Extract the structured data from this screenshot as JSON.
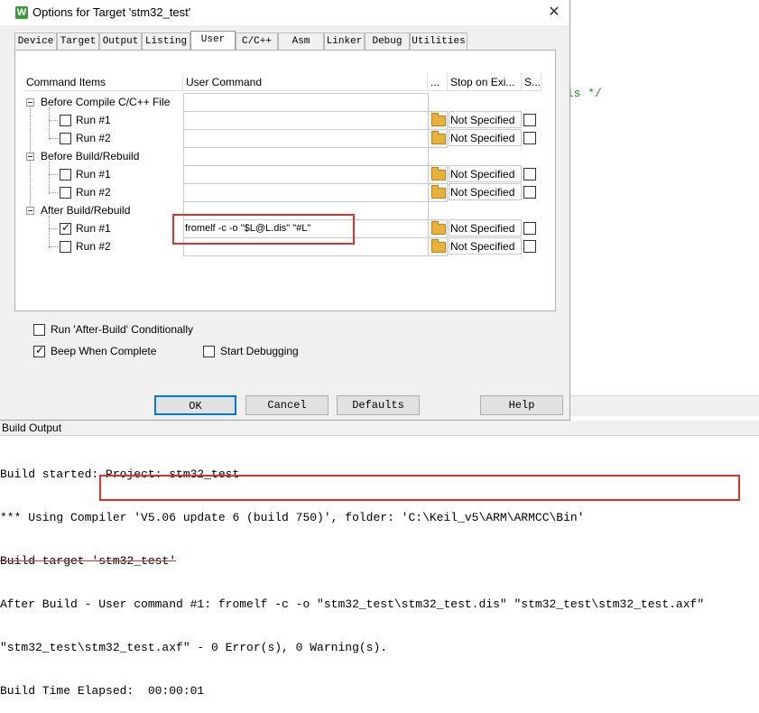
{
  "background": {
    "code_snippet": "als */"
  },
  "dialog": {
    "title": "Options for Target 'stm32_test'",
    "title_icon": "W",
    "close_glyph": "✕",
    "tabs": [
      "Device",
      "Target",
      "Output",
      "Listing",
      "User",
      "C/C++",
      "Asm",
      "Linker",
      "Debug",
      "Utilities"
    ],
    "active_tab": "User",
    "grid": {
      "headers": [
        "Command Items",
        "User Command",
        "...",
        "Stop on Exi...",
        "S..."
      ],
      "groups": [
        {
          "label": "Before Compile C/C++ File",
          "runs": [
            {
              "label": "Run #1",
              "checked": false,
              "command": "",
              "stop": "Not Specified"
            },
            {
              "label": "Run #2",
              "checked": false,
              "command": "",
              "stop": "Not Specified"
            }
          ]
        },
        {
          "label": "Before Build/Rebuild",
          "runs": [
            {
              "label": "Run #1",
              "checked": false,
              "command": "",
              "stop": "Not Specified"
            },
            {
              "label": "Run #2",
              "checked": false,
              "command": "",
              "stop": "Not Specified"
            }
          ]
        },
        {
          "label": "After Build/Rebuild",
          "runs": [
            {
              "label": "Run #1",
              "checked": true,
              "command": "fromelf -c -o \"$L@L.dis\" \"#L\"",
              "stop": "Not Specified"
            },
            {
              "label": "Run #2",
              "checked": false,
              "command": "",
              "stop": "Not Specified"
            }
          ]
        }
      ]
    },
    "options": {
      "run_after_build_conditionally": {
        "label": "Run 'After-Build' Conditionally",
        "checked": false
      },
      "beep_when_complete": {
        "label": "Beep When Complete",
        "checked": true
      },
      "start_debugging": {
        "label": "Start Debugging",
        "checked": false
      }
    },
    "buttons": {
      "ok": "OK",
      "cancel": "Cancel",
      "defaults": "Defaults",
      "help": "Help"
    }
  },
  "build_output": {
    "title": "Build Output",
    "lines": [
      "Build started: Project: stm32_test",
      "*** Using Compiler 'V5.06 update 6 (build 750)', folder: 'C:\\Keil_v5\\ARM\\ARMCC\\Bin'",
      "Build target 'stm32_test'",
      "After Build - User command #1: fromelf -c -o \"stm32_test\\stm32_test.dis\" \"stm32_test\\stm32_test.axf\"",
      "\"stm32_test\\stm32_test.axf\" - 0 Error(s), 0 Warning(s).",
      "Build Time Elapsed:  00:00:01"
    ]
  },
  "colors": {
    "highlight": "#e0302a",
    "accent": "#0078d7",
    "code_comment": "#1a8a1a"
  }
}
